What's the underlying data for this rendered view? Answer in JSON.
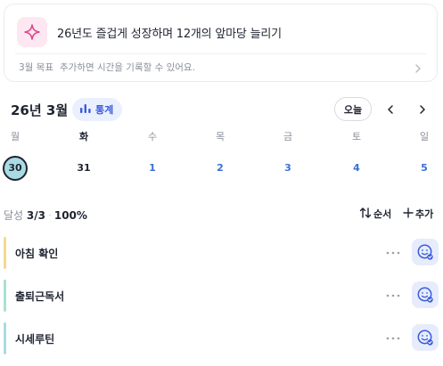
{
  "goal": {
    "title": "26년도 즐겁게 성장하며 12개의 앞마당 늘리기",
    "hint_prefix": "3월 목표",
    "hint_text": "추가하면 시간을 기록할 수 있어요.",
    "icon": "sparkle-icon",
    "chevron_icon": "chevron-right-icon"
  },
  "calendar": {
    "month_label": "26년 3월",
    "stats_label": "통계",
    "today_label": "오늘",
    "days": [
      {
        "dow": "월",
        "date": "30",
        "state": "selected"
      },
      {
        "dow": "화",
        "date": "31",
        "state": "past"
      },
      {
        "dow": "수",
        "date": "1",
        "state": "future"
      },
      {
        "dow": "목",
        "date": "2",
        "state": "future"
      },
      {
        "dow": "금",
        "date": "3",
        "state": "future"
      },
      {
        "dow": "토",
        "date": "4",
        "state": "future"
      },
      {
        "dow": "일",
        "date": "5",
        "state": "future"
      }
    ]
  },
  "progress": {
    "label": "달성",
    "count": "3/3",
    "percent": "100%",
    "sort_label": "순서",
    "add_label": "추가"
  },
  "routines": [
    {
      "name": "아침 확인",
      "color": "#f6d98c"
    },
    {
      "name": "출퇴근독서",
      "color": "#a9e0d6"
    },
    {
      "name": "시세루틴",
      "color": "#a9dbe5"
    }
  ],
  "colors": {
    "accent": "#3b5bdb",
    "selected_fill": "#a9dbe5",
    "icon_bg": "#fde7f0",
    "check_bg": "#e6ecfb"
  }
}
